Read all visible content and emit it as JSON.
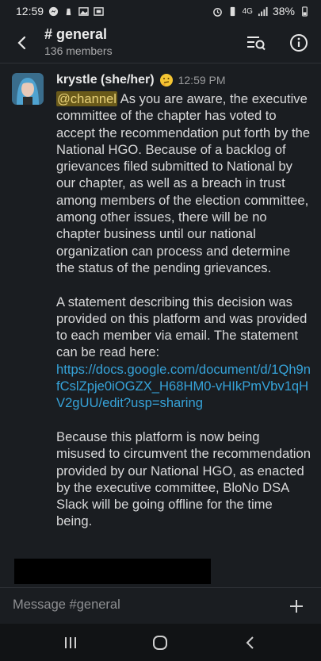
{
  "status": {
    "time": "12:59",
    "network": "4G",
    "battery": "38%"
  },
  "header": {
    "channel_name": "# general",
    "member_count": "136 members"
  },
  "message": {
    "author": "krystle (she/her)",
    "timestamp": "12:59 PM",
    "mention": "@channel",
    "para1": " As you are aware, the executive committee of the chapter has voted to accept the recommendation put forth by the National HGO. Because of a backlog of grievances filed submitted to National by our chapter, as well as a breach in trust among members of the election committee, among other issues, there will be no chapter business until our national organization can process and determine the status of the pending grievances.",
    "para2": "A statement describing this decision was provided on this platform and was provided to each member via email. The statement can be read here:",
    "link": "https://docs.google.com/document/d/1Qh9nfCslZpje0iOGZX_H68HM0-vHIkPmVbv1qHV2gUU/edit?usp=sharing",
    "para3": "Because this platform is now being misused to circumvent the recommendation provided by our National HGO, as enacted by the executive committee, BloNo DSA Slack will be going offline for the time being."
  },
  "composer": {
    "placeholder": "Message #general"
  },
  "icons": {
    "back": "back-arrow-icon",
    "search": "search-list-icon",
    "info": "info-icon",
    "add": "plus-icon",
    "emoji": "thinking-face-icon"
  },
  "colors": {
    "background": "#1a1d21",
    "link": "#36a3d9",
    "mention_bg": "#6a5a1a",
    "mention_text": "#e9d27a"
  }
}
